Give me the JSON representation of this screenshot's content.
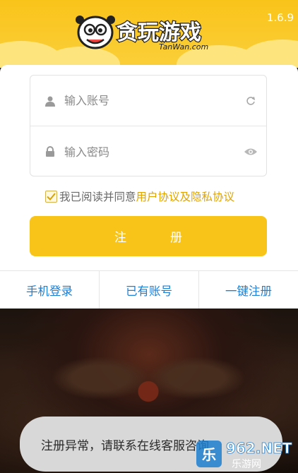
{
  "header": {
    "brand_cn": "贪玩游戏",
    "brand_en": "TanWan.com",
    "version": "1.6.9",
    "accent_color": "#f9c41a"
  },
  "form": {
    "account": {
      "placeholder": "输入账号",
      "lead_icon": "user-icon",
      "trail_icon": "refresh-icon"
    },
    "password": {
      "placeholder": "输入密码",
      "lead_icon": "lock-icon",
      "trail_icon": "eye-icon"
    },
    "agreement": {
      "checked": true,
      "static_text": "我已阅读并同意",
      "link_text": "用户协议及隐私协议"
    },
    "register_label": "注册"
  },
  "bottom_tabs": [
    {
      "label": "手机登录"
    },
    {
      "label": "已有账号"
    },
    {
      "label": "一键注册"
    }
  ],
  "toast": {
    "message": "注册异常，请联系在线客服咨询"
  },
  "watermark": {
    "top": "962.NET",
    "bottom": "乐游网"
  }
}
